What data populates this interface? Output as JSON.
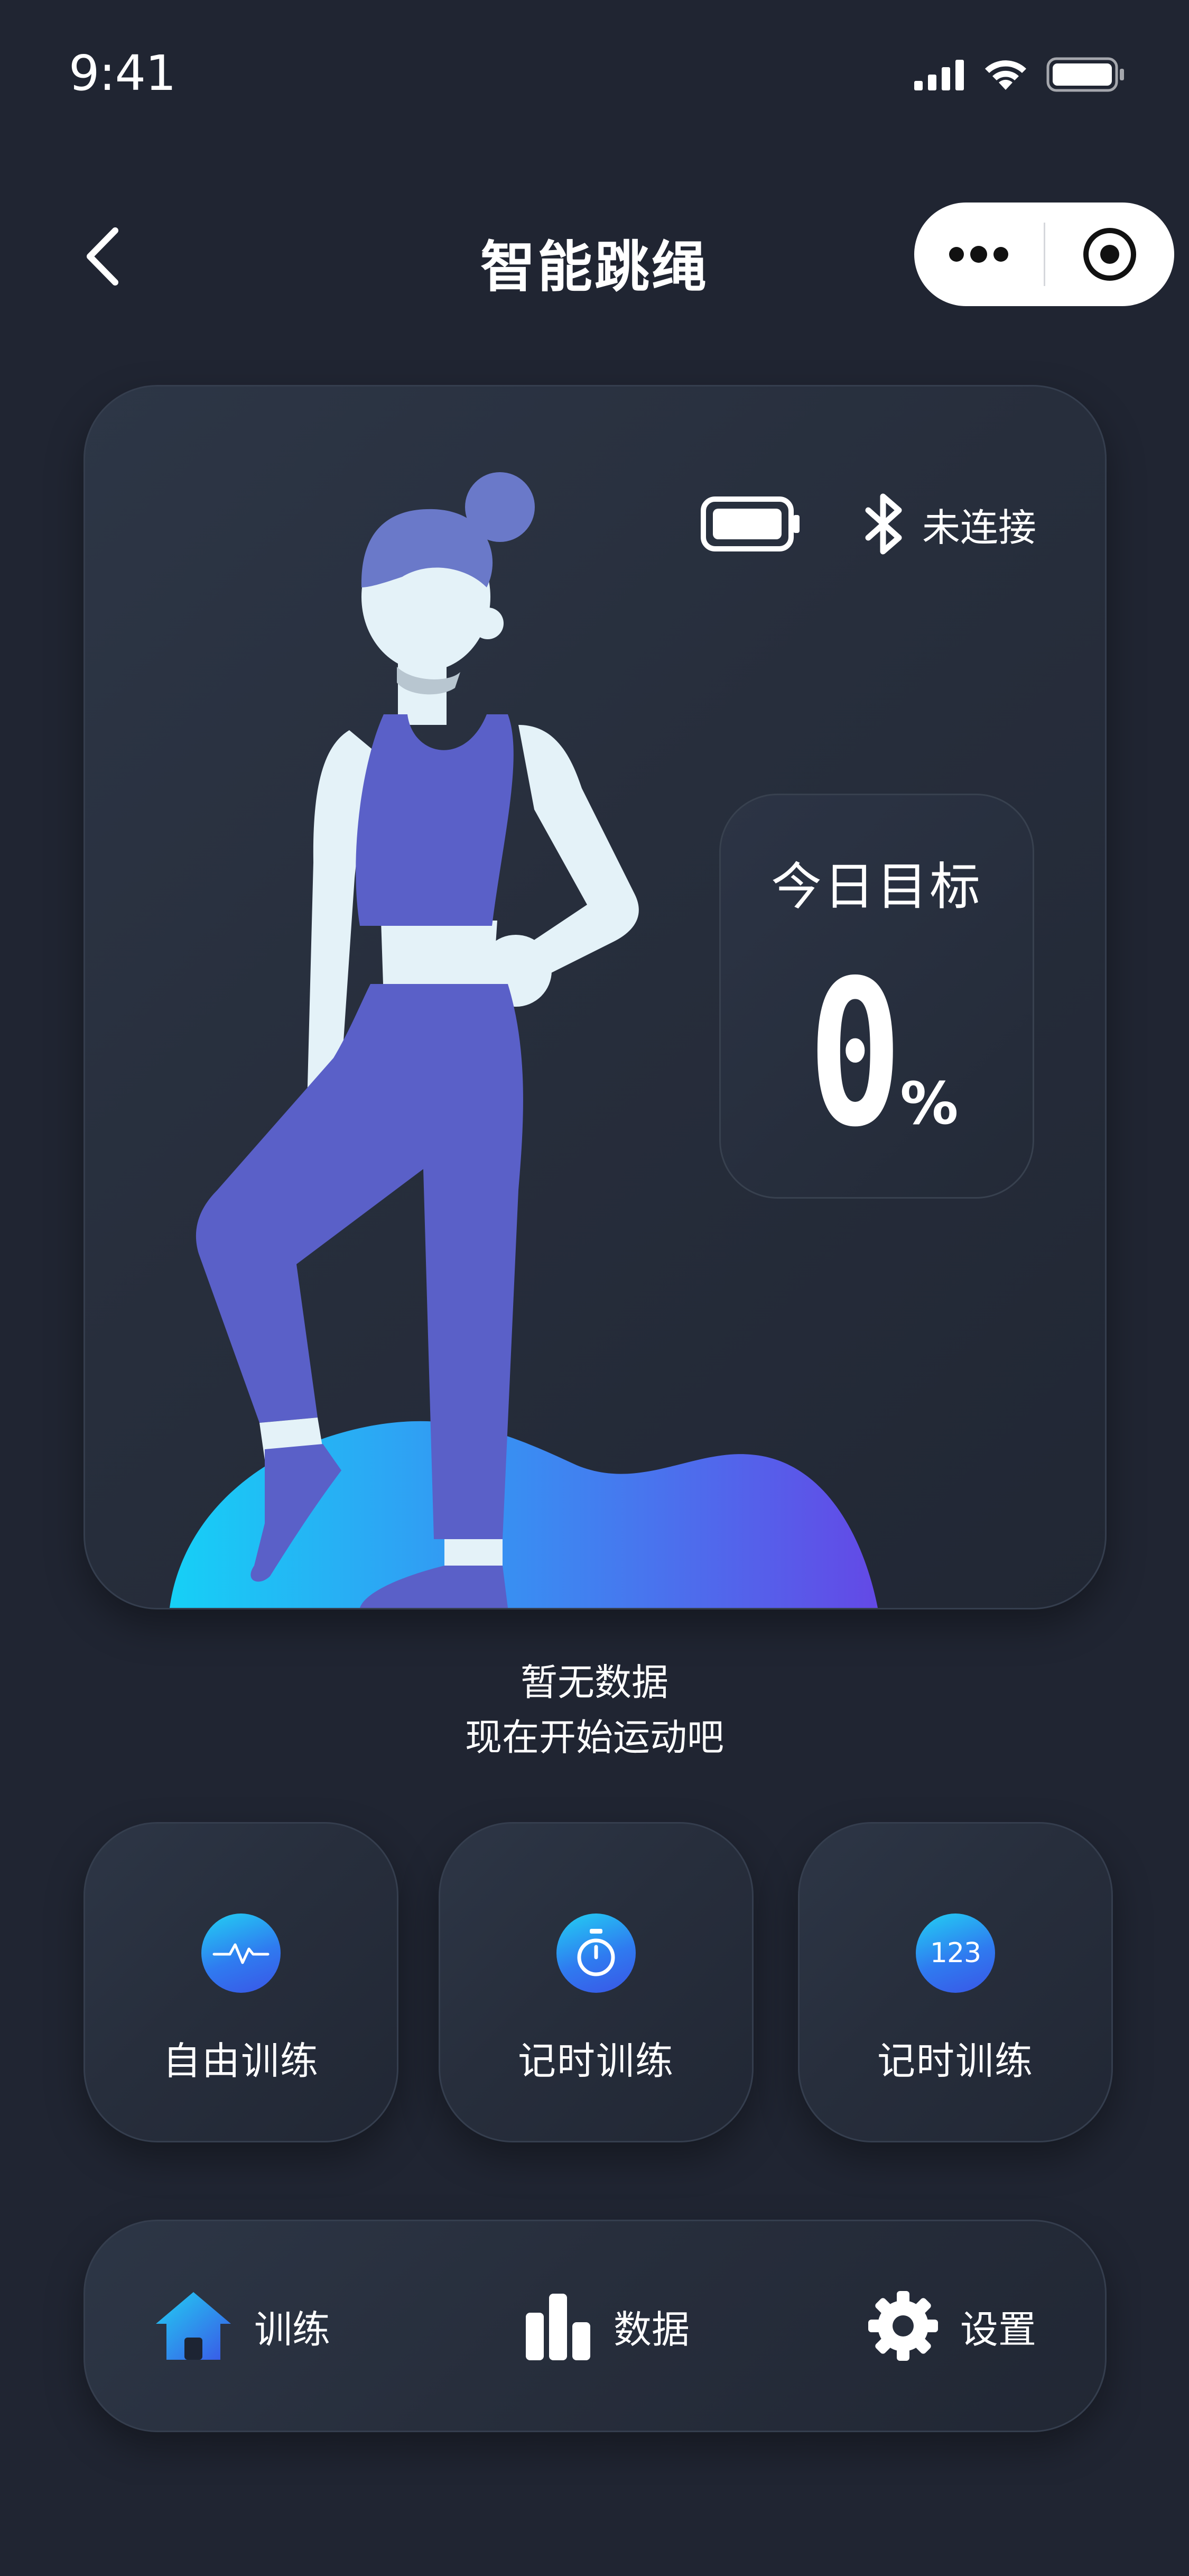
{
  "status_bar": {
    "time": "9:41"
  },
  "nav": {
    "title": "智能跳绳"
  },
  "device": {
    "connection": "未连接"
  },
  "goal": {
    "title": "今日目标",
    "value": "0",
    "unit": "%",
    "progress_percent": 0
  },
  "empty_state": {
    "line1": "暂无数据",
    "line2": "现在开始运动吧"
  },
  "modes": [
    {
      "label": "自由训练",
      "icon": "pulse-icon"
    },
    {
      "label": "记时训练",
      "icon": "stopwatch-icon"
    },
    {
      "label": "记时训练",
      "icon": "count-123-icon",
      "icon_text": "123"
    }
  ],
  "tabs": [
    {
      "label": "训练",
      "icon": "home-icon"
    },
    {
      "label": "数据",
      "icon": "bar-chart-icon"
    },
    {
      "label": "设置",
      "icon": "gear-icon"
    }
  ],
  "colors": {
    "background": "#202532",
    "accent_start": "#22d1f3",
    "accent_end": "#5b4be8",
    "figure_outfit": "#5a60c8"
  }
}
